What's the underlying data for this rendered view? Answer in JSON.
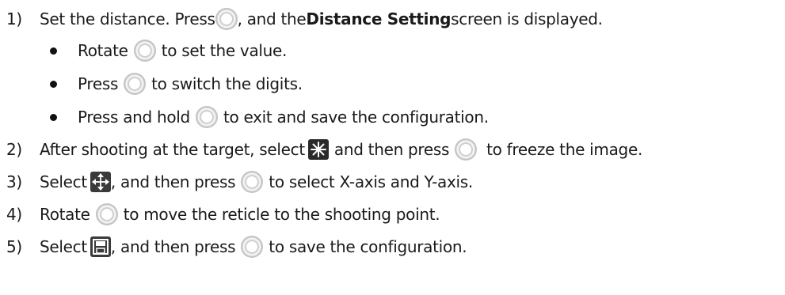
{
  "steps": [
    {
      "number": "1)",
      "parts": [
        "Set the distance. Press ",
        ", and the ",
        "Distance Setting",
        " screen is displayed."
      ]
    },
    {
      "number": "2)",
      "parts": [
        "After shooting at the target, select ",
        " and then press ",
        " to freeze the image."
      ]
    },
    {
      "number": "3)",
      "parts": [
        "Select ",
        ", and then press ",
        " to select X-axis and Y-axis."
      ]
    },
    {
      "number": "4)",
      "parts": [
        "Rotate ",
        " to move the reticle to the shooting point."
      ]
    },
    {
      "number": "5)",
      "parts": [
        "Select ",
        ", and then press ",
        " to save the configuration."
      ]
    }
  ],
  "bullets": [
    {
      "parts": [
        "Rotate ",
        " to set the value."
      ]
    },
    {
      "parts": [
        "Press ",
        " to switch the digits."
      ]
    },
    {
      "parts": [
        "Press and hold ",
        " to exit and save the configuration."
      ]
    }
  ],
  "icons": {
    "knob": "knob-button-icon",
    "freeze": "freeze-snowflake-icon",
    "move": "four-way-arrows-icon",
    "save": "save-floppy-icon"
  }
}
